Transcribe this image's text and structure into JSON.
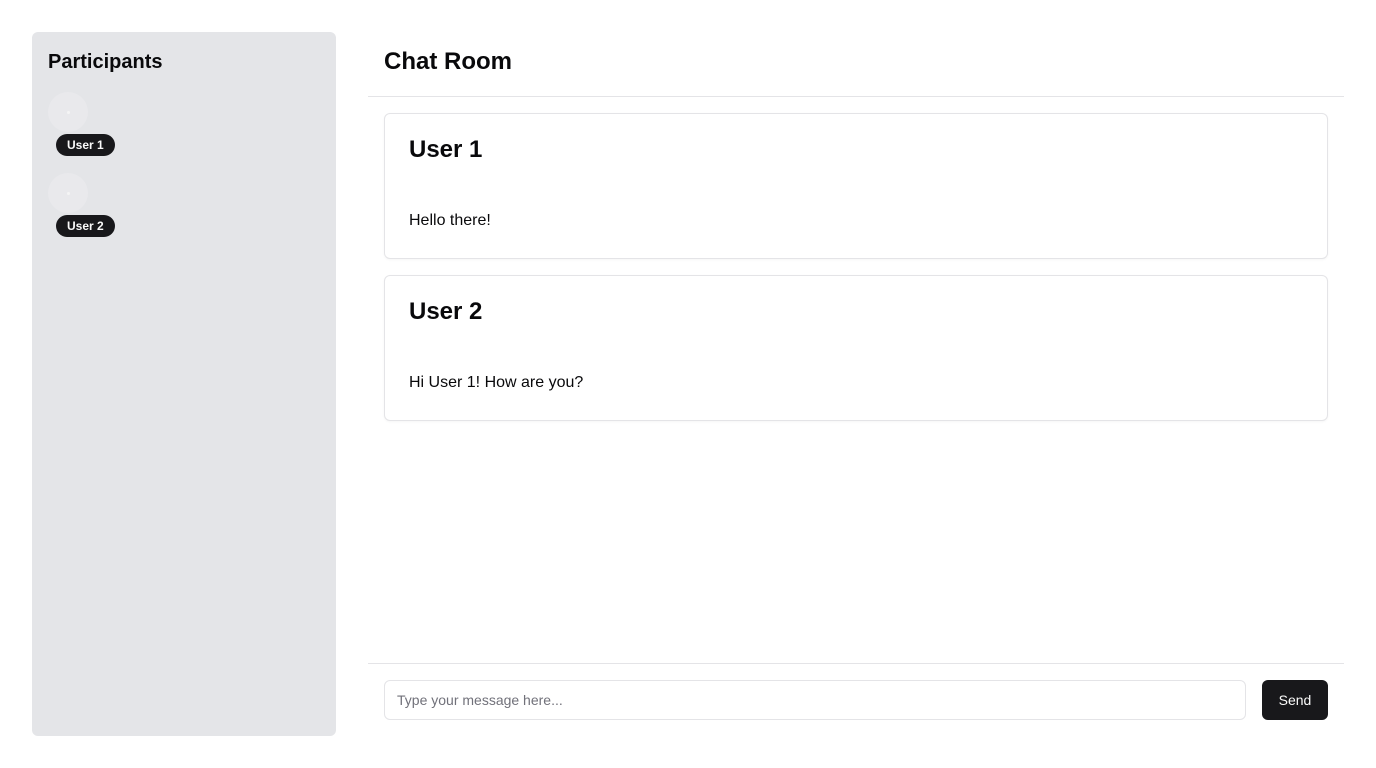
{
  "sidebar": {
    "title": "Participants",
    "participants": [
      {
        "name": "User 1",
        "avatar_icon": "avatar-placeholder-icon"
      },
      {
        "name": "User 2",
        "avatar_icon": "avatar-placeholder-icon"
      }
    ]
  },
  "chat": {
    "title": "Chat Room",
    "messages": [
      {
        "author": "User 1",
        "text": "Hello there!"
      },
      {
        "author": "User 2",
        "text": "Hi User 1! How are you?"
      }
    ]
  },
  "composer": {
    "input_value": "",
    "input_placeholder": "Type your message here...",
    "send_label": "Send"
  },
  "colors": {
    "sidebar_bg": "#e4e5e8",
    "badge_bg": "#18181b",
    "button_bg": "#18181b",
    "border": "#e4e4e7",
    "text": "#09090b"
  }
}
